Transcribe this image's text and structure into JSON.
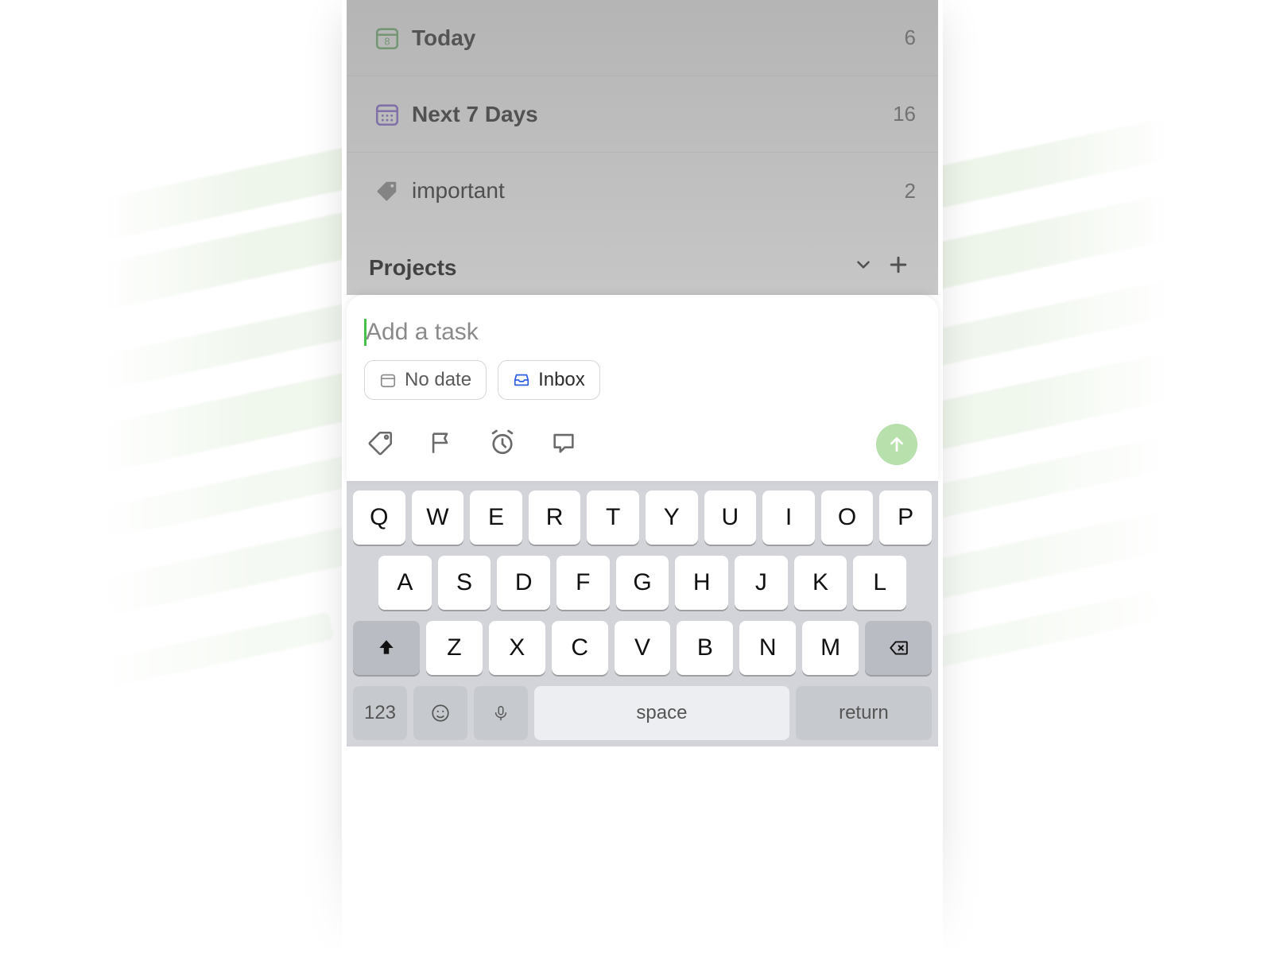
{
  "colors": {
    "accent_green": "#46c24a",
    "send_bg": "#b7e0ac",
    "inbox_blue": "#2f5fe0",
    "purple": "#8a6ad8"
  },
  "list": {
    "today": {
      "label": "Today",
      "count": "6",
      "icon": "calendar-today-icon",
      "icon_badge": "8"
    },
    "next7": {
      "label": "Next 7 Days",
      "count": "16",
      "icon": "calendar-week-icon"
    },
    "important": {
      "label": "important",
      "count": "2",
      "icon": "tag-icon"
    }
  },
  "section": {
    "label": "Projects"
  },
  "compose": {
    "placeholder": "Add a task",
    "date_chip": {
      "label": "No date"
    },
    "list_chip": {
      "label": "Inbox"
    }
  },
  "keyboard": {
    "row1": [
      "Q",
      "W",
      "E",
      "R",
      "T",
      "Y",
      "U",
      "I",
      "O",
      "P"
    ],
    "row2": [
      "A",
      "S",
      "D",
      "F",
      "G",
      "H",
      "J",
      "K",
      "L"
    ],
    "row3": [
      "Z",
      "X",
      "C",
      "V",
      "B",
      "N",
      "M"
    ],
    "num_label": "123",
    "space_label": "space",
    "return_label": "return"
  }
}
